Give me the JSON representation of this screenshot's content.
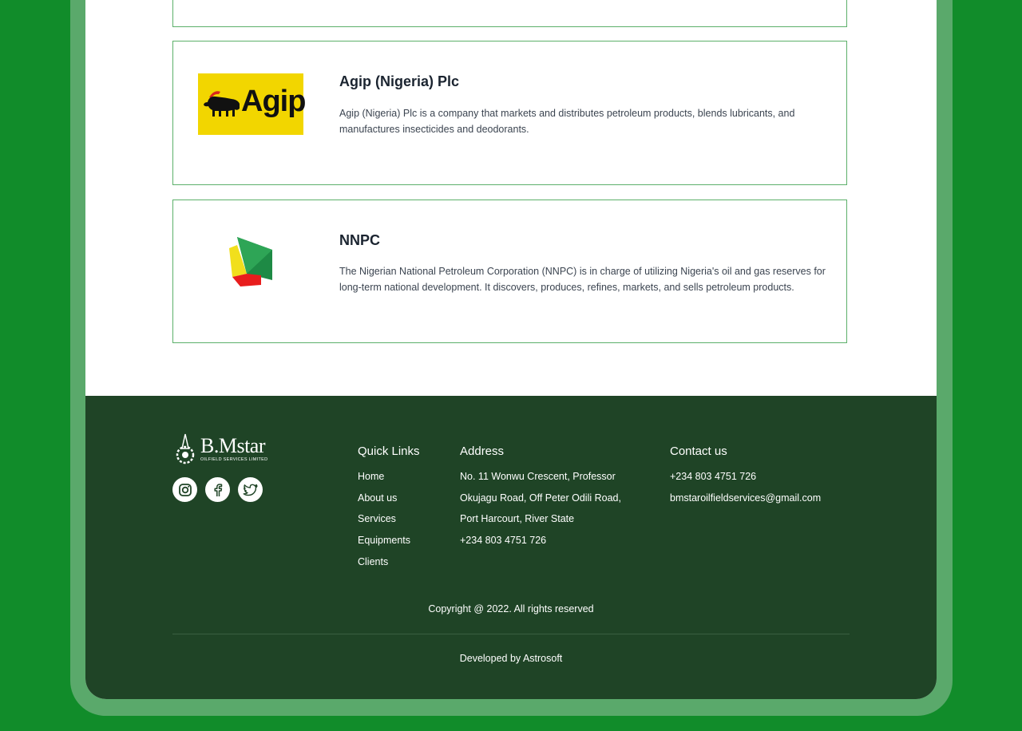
{
  "clients": [
    {
      "name": "Agip (Nigeria) Plc",
      "description": "Agip (Nigeria) Plc is a company that markets and distributes petroleum products, blends lubricants, and manufactures insecticides and deodorants.",
      "logo_text": "Agip"
    },
    {
      "name": "NNPC",
      "description": "The Nigerian National Petroleum Corporation (NNPC) is in charge of utilizing Nigeria's oil and gas reserves for long-term national development. It discovers, produces, refines, markets, and sells petroleum products."
    }
  ],
  "footer": {
    "brand_name": "B.Mstar",
    "brand_sub": "OILFIELD SERVICES LIMITED",
    "social_icons": [
      "instagram-icon",
      "facebook-icon",
      "twitter-icon"
    ],
    "quick_links": {
      "title": "Quick Links",
      "items": [
        "Home",
        "About us",
        "Services",
        "Equipments",
        "Clients"
      ]
    },
    "address": {
      "title": "Address",
      "lines": [
        "No. 11 Wonwu Crescent, Professor",
        "Okujagu Road, Off Peter Odili Road,",
        "Port Harcourt, River State",
        "+234 803 4751 726"
      ]
    },
    "contact": {
      "title": "Contact us",
      "lines": [
        "+234 803 4751 726",
        "bmstaroilfieldservices@gmail.com"
      ]
    },
    "copyright": "Copyright @ 2022. All rights reserved",
    "developed_by": "Developed by Astrosoft"
  },
  "colors": {
    "page_background": "#118c2a",
    "frame": "#5aa96b",
    "footer_background": "#1f4426",
    "card_border": "#5cb06a",
    "agip_yellow": "#f2d600"
  }
}
